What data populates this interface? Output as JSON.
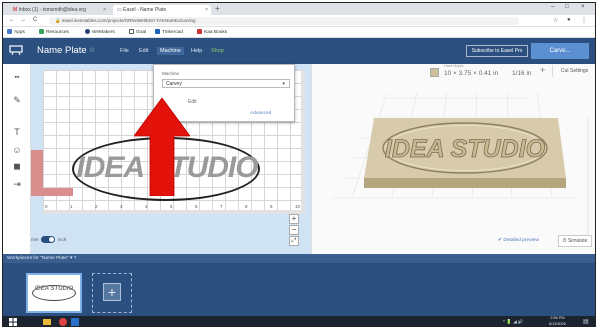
{
  "browser": {
    "tabs": [
      {
        "label": "Inbox (1) - tsmsmith@idea.org",
        "active": false
      },
      {
        "label": "Easel - Name Plate",
        "active": true
      }
    ],
    "new_tab": "+",
    "window_controls": [
      "–",
      "□",
      "×"
    ],
    "nav": {
      "back": "←",
      "forward": "→",
      "reload": "C"
    },
    "url": "easel.inventables.com/projects/GRNxWe9bGrr-TAKNamEx/carving",
    "bookmarks": [
      "Apps",
      "Resources",
      "WeMakers",
      "Goal",
      "Tinkercad",
      "Kaa Books"
    ]
  },
  "app": {
    "title": "Name Plate",
    "star": "☆",
    "menus": [
      "File",
      "Edit",
      "Machine",
      "Help",
      "Shop"
    ],
    "active_menu": "Machine",
    "subscribe_label": "Subscribe to Easel Pro",
    "carve_label": "Carve..."
  },
  "toolbar": {
    "tools": [
      {
        "name": "shapes-icon",
        "glyph": "▪▪"
      },
      {
        "name": "pen-icon",
        "glyph": "✎"
      },
      {
        "name": "text-icon",
        "glyph": "T"
      },
      {
        "name": "icons-icon",
        "glyph": "☺"
      },
      {
        "name": "apps-icon",
        "glyph": "◼"
      },
      {
        "name": "import-icon",
        "glyph": "⇥"
      }
    ]
  },
  "design": {
    "logo_text": "IDEA STUDIO",
    "ruler_ticks": [
      "0",
      "1",
      "2",
      "3",
      "4",
      "5",
      "6",
      "7",
      "8",
      "9",
      "10"
    ],
    "zoom_in": "+",
    "zoom_out": "−",
    "toggle_left": "mm",
    "toggle_right": "inch"
  },
  "machine_popup": {
    "label": "Machine",
    "selected": "Carvey",
    "edit_label": "Edit",
    "link_label": "Advanced"
  },
  "preview": {
    "material_label": "Hard Maple",
    "dimensions": "10 × 3.75 × 0.41 in",
    "bit": "1/16 in",
    "add_label": "+",
    "cut_settings_label": "Cut Settings",
    "board_text": "IDEA STUDIO",
    "detailed_preview_label": "✔ Detailed preview",
    "simulate_label": "⏱ Simulate"
  },
  "workpieces": {
    "title": "Workpieces for \"Name Plate\"  ▾  ?",
    "thumb_text": "IDEA STUDIO",
    "add_label": "+"
  },
  "taskbar": {
    "time": "2:56 PM",
    "date": "6/13/2020",
    "tray": "^  🔋 ◢ 🔊"
  },
  "colors": {
    "header": "#2b4f7e",
    "carve_button": "#5c8fd1",
    "arrow": "#e3120b",
    "board": "#cdbf9c"
  }
}
